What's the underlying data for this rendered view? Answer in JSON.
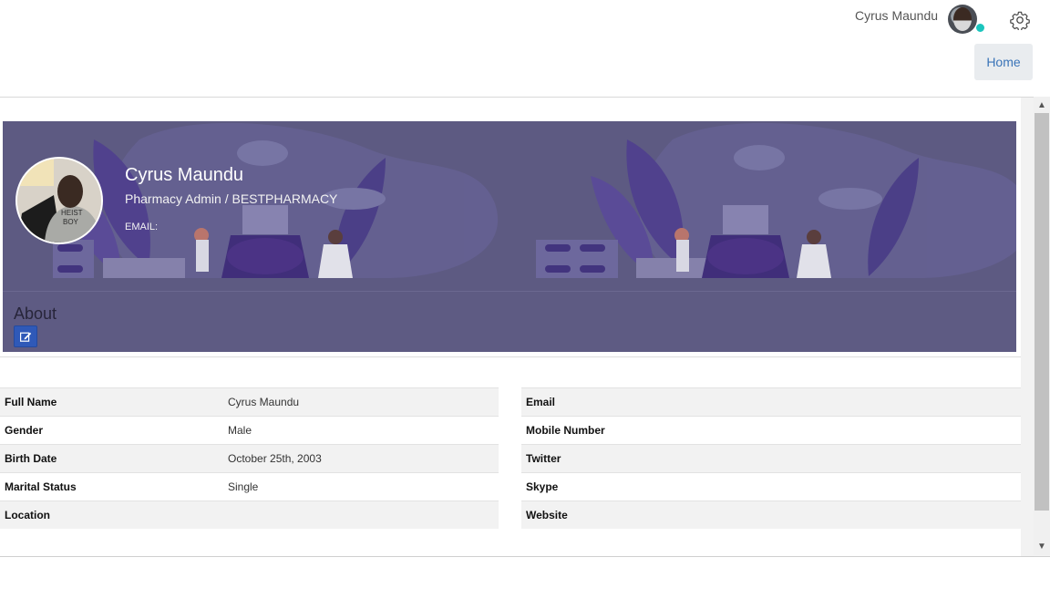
{
  "header": {
    "user_name": "Cyrus Maundu",
    "home_label": "Home",
    "avatar_icon": "user-avatar",
    "settings_icon": "gear-icon",
    "online_status_color": "#1bc5bd"
  },
  "profile": {
    "name": "Cyrus Maundu",
    "role": "Pharmacy Admin / BESTPHARMACY",
    "email_label": "EMAIL:",
    "banner_color": "#5d5a82"
  },
  "about": {
    "title": "About",
    "edit_icon": "edit-icon",
    "edit_button_color": "#2f59b8"
  },
  "details_left": [
    {
      "label": "Full Name",
      "value": "Cyrus Maundu"
    },
    {
      "label": "Gender",
      "value": "Male"
    },
    {
      "label": "Birth Date",
      "value": "October 25th, 2003"
    },
    {
      "label": "Marital Status",
      "value": "Single"
    },
    {
      "label": "Location",
      "value": ""
    }
  ],
  "details_right": [
    {
      "label": "Email",
      "value": ""
    },
    {
      "label": "Mobile Number",
      "value": ""
    },
    {
      "label": "Twitter",
      "value": ""
    },
    {
      "label": "Skype",
      "value": ""
    },
    {
      "label": "Website",
      "value": ""
    }
  ]
}
